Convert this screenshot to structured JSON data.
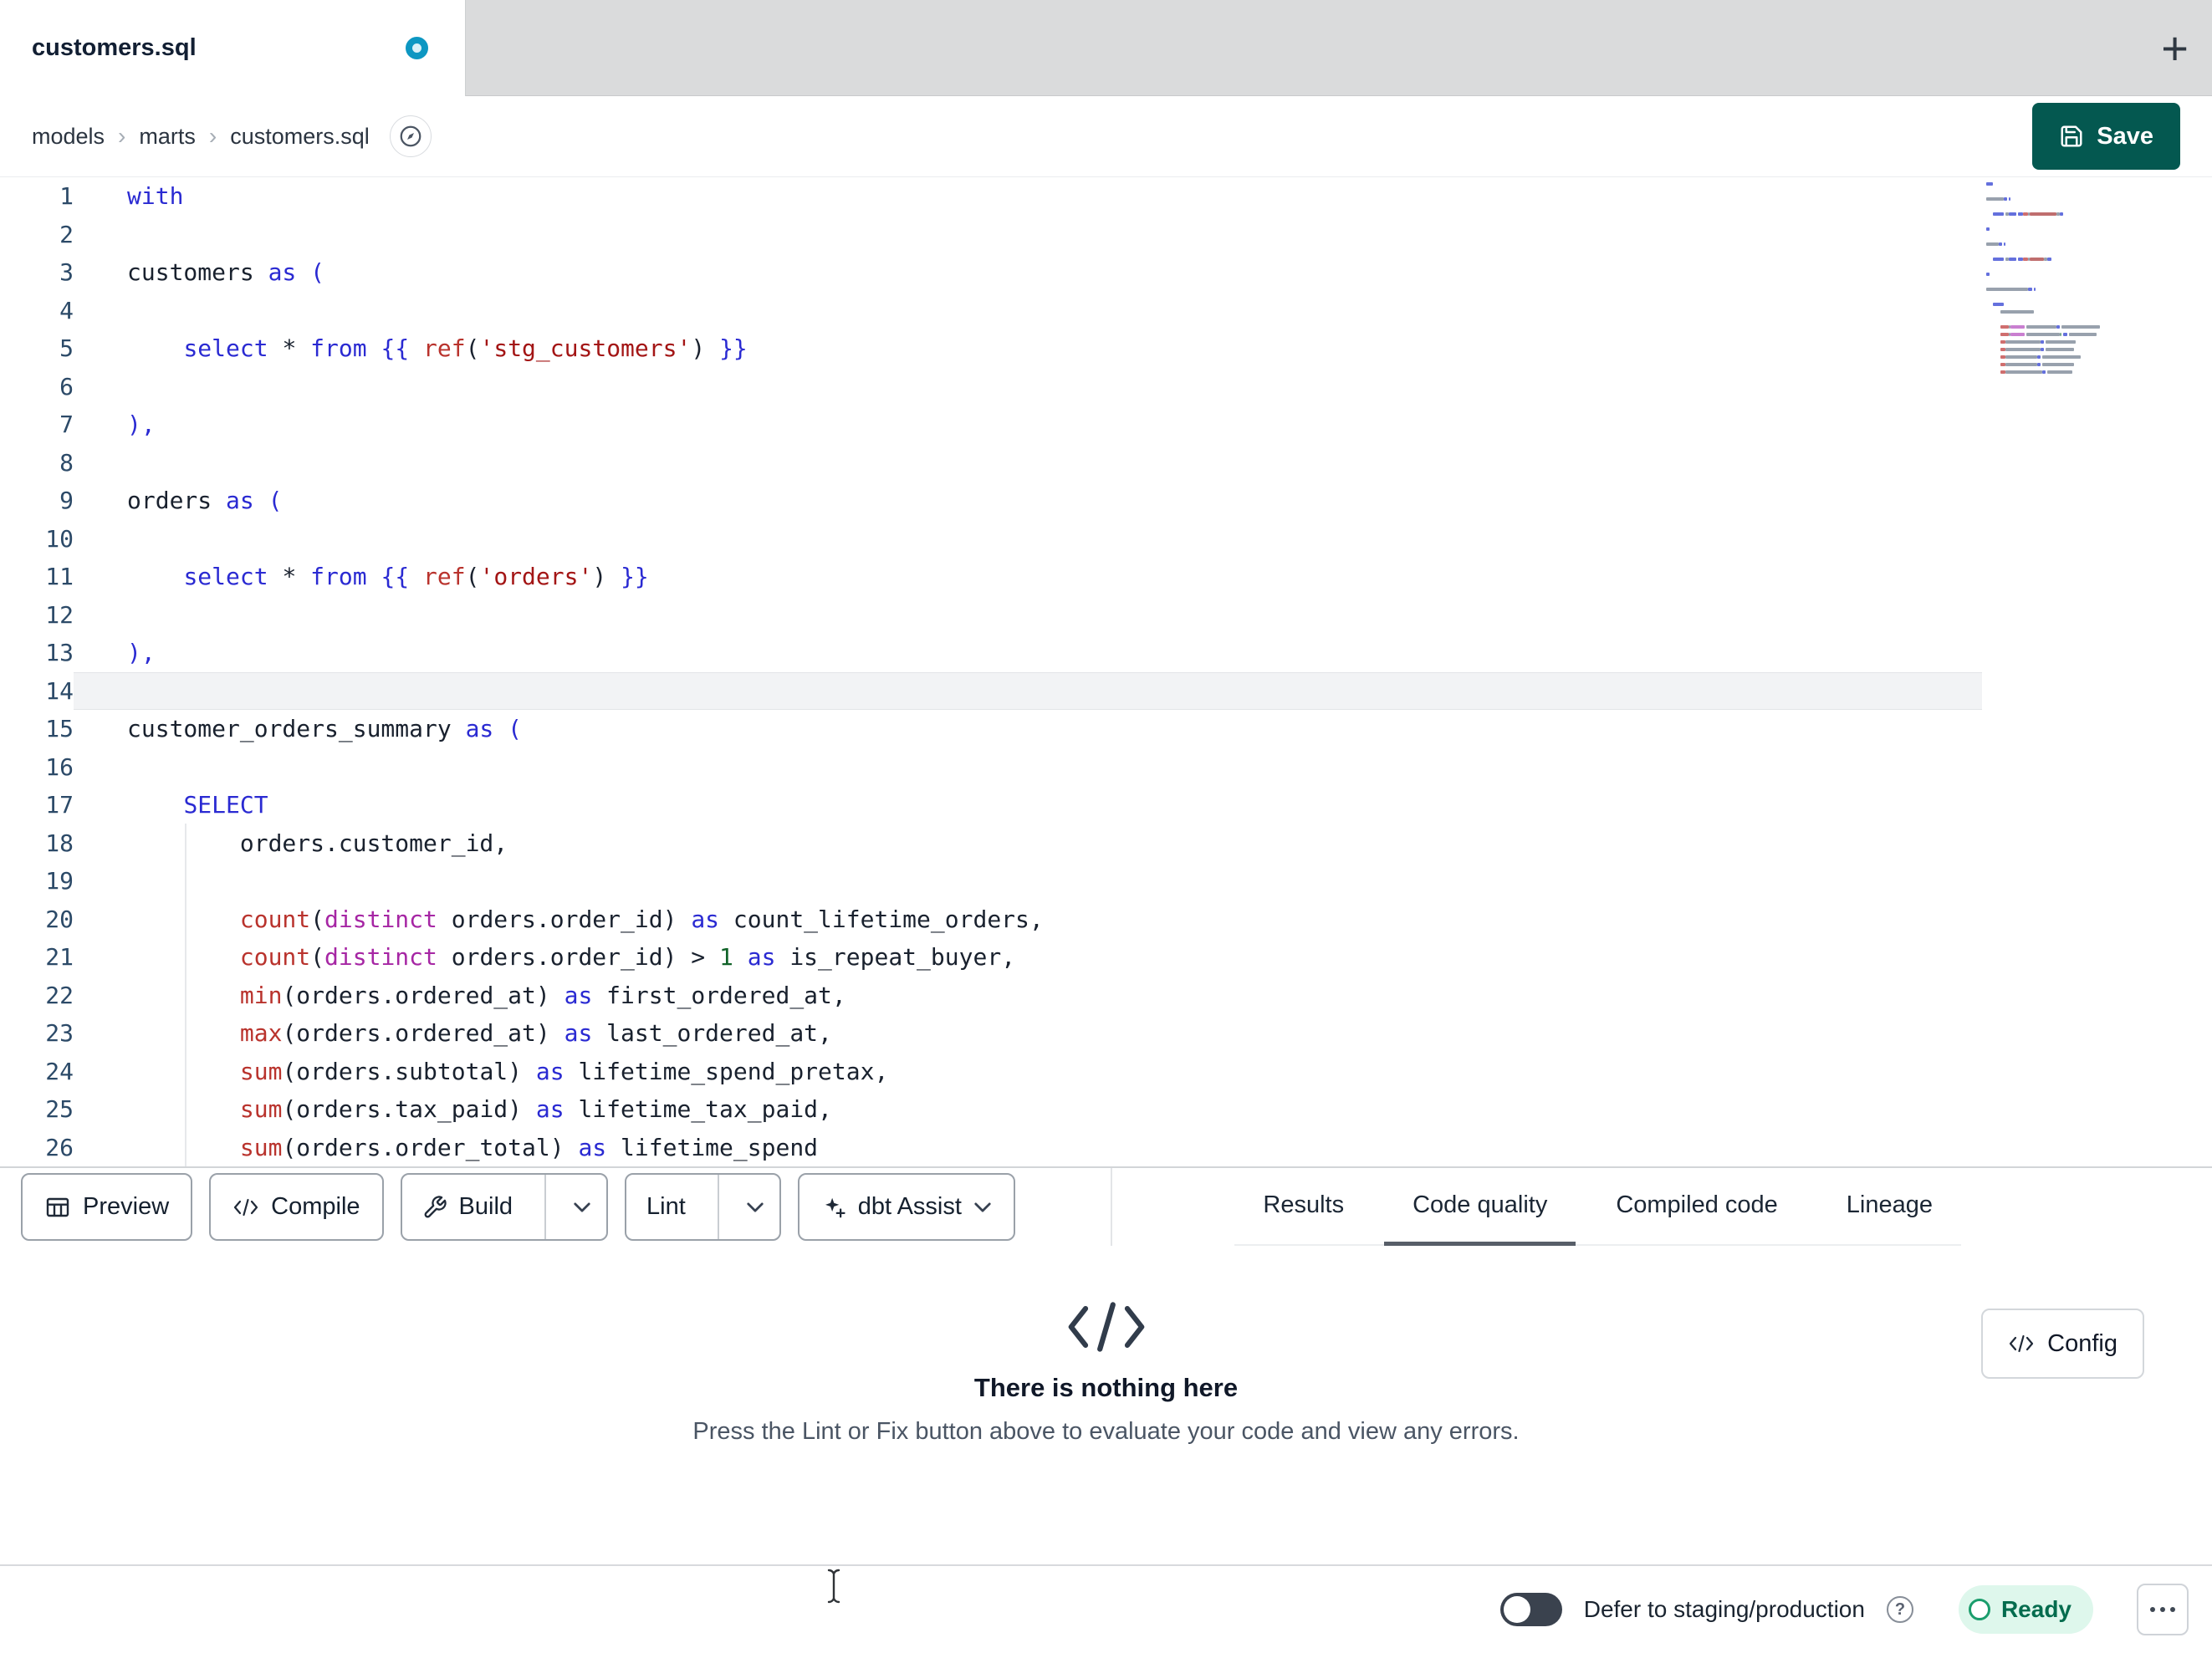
{
  "tab_bar": {
    "tab_title": "customers.sql",
    "new_tab_label": "+"
  },
  "breadcrumb": {
    "items": [
      "models",
      "marts",
      "customers.sql"
    ],
    "save_label": "Save"
  },
  "editor": {
    "current_line": 14,
    "lines": [
      {
        "n": 1,
        "segs": [
          [
            "kw",
            "with"
          ]
        ]
      },
      {
        "n": 2,
        "segs": []
      },
      {
        "n": 3,
        "segs": [
          [
            "pl",
            "customers "
          ],
          [
            "kw",
            "as"
          ],
          [
            "pl",
            " "
          ],
          [
            "br",
            "("
          ]
        ]
      },
      {
        "n": 4,
        "segs": []
      },
      {
        "n": 5,
        "segs": [
          [
            "pl",
            "    "
          ],
          [
            "kw",
            "select"
          ],
          [
            "pl",
            " * "
          ],
          [
            "kw",
            "from"
          ],
          [
            "pl",
            " "
          ],
          [
            "br",
            "{{ "
          ],
          [
            "fn",
            "ref"
          ],
          [
            "pl",
            "("
          ],
          [
            "str",
            "'stg_customers'"
          ],
          [
            "pl",
            ") "
          ],
          [
            "br",
            "}}"
          ]
        ]
      },
      {
        "n": 6,
        "segs": []
      },
      {
        "n": 7,
        "segs": [
          [
            "br",
            "),"
          ]
        ]
      },
      {
        "n": 8,
        "segs": []
      },
      {
        "n": 9,
        "segs": [
          [
            "pl",
            "orders "
          ],
          [
            "kw",
            "as"
          ],
          [
            "pl",
            " "
          ],
          [
            "br",
            "("
          ]
        ]
      },
      {
        "n": 10,
        "segs": []
      },
      {
        "n": 11,
        "segs": [
          [
            "pl",
            "    "
          ],
          [
            "kw",
            "select"
          ],
          [
            "pl",
            " * "
          ],
          [
            "kw",
            "from"
          ],
          [
            "pl",
            " "
          ],
          [
            "br",
            "{{ "
          ],
          [
            "fn",
            "ref"
          ],
          [
            "pl",
            "("
          ],
          [
            "str",
            "'orders'"
          ],
          [
            "pl",
            ") "
          ],
          [
            "br",
            "}}"
          ]
        ]
      },
      {
        "n": 12,
        "segs": []
      },
      {
        "n": 13,
        "segs": [
          [
            "br",
            "),"
          ]
        ]
      },
      {
        "n": 14,
        "segs": []
      },
      {
        "n": 15,
        "segs": [
          [
            "pl",
            "customer_orders_summary "
          ],
          [
            "kw",
            "as"
          ],
          [
            "pl",
            " "
          ],
          [
            "br",
            "("
          ]
        ]
      },
      {
        "n": 16,
        "segs": []
      },
      {
        "n": 17,
        "segs": [
          [
            "pl",
            "    "
          ],
          [
            "kw",
            "SELECT"
          ]
        ]
      },
      {
        "n": 18,
        "segs": [
          [
            "pl",
            "        orders.customer_id,"
          ]
        ]
      },
      {
        "n": 19,
        "segs": []
      },
      {
        "n": 20,
        "segs": [
          [
            "pl",
            "        "
          ],
          [
            "fn",
            "count"
          ],
          [
            "pl",
            "("
          ],
          [
            "typ",
            "distinct"
          ],
          [
            "pl",
            " orders.order_id) "
          ],
          [
            "kw",
            "as"
          ],
          [
            "pl",
            " count_lifetime_orders,"
          ]
        ]
      },
      {
        "n": 21,
        "segs": [
          [
            "pl",
            "        "
          ],
          [
            "fn",
            "count"
          ],
          [
            "pl",
            "("
          ],
          [
            "typ",
            "distinct"
          ],
          [
            "pl",
            " orders.order_id) > "
          ],
          [
            "num",
            "1"
          ],
          [
            "pl",
            " "
          ],
          [
            "kw",
            "as"
          ],
          [
            "pl",
            " is_repeat_buyer,"
          ]
        ]
      },
      {
        "n": 22,
        "segs": [
          [
            "pl",
            "        "
          ],
          [
            "fn",
            "min"
          ],
          [
            "pl",
            "(orders.ordered_at) "
          ],
          [
            "kw",
            "as"
          ],
          [
            "pl",
            " first_ordered_at,"
          ]
        ]
      },
      {
        "n": 23,
        "segs": [
          [
            "pl",
            "        "
          ],
          [
            "fn",
            "max"
          ],
          [
            "pl",
            "(orders.ordered_at) "
          ],
          [
            "kw",
            "as"
          ],
          [
            "pl",
            " last_ordered_at,"
          ]
        ]
      },
      {
        "n": 24,
        "segs": [
          [
            "pl",
            "        "
          ],
          [
            "fn",
            "sum"
          ],
          [
            "pl",
            "(orders.subtotal) "
          ],
          [
            "kw",
            "as"
          ],
          [
            "pl",
            " lifetime_spend_pretax,"
          ]
        ]
      },
      {
        "n": 25,
        "segs": [
          [
            "pl",
            "        "
          ],
          [
            "fn",
            "sum"
          ],
          [
            "pl",
            "(orders.tax_paid) "
          ],
          [
            "kw",
            "as"
          ],
          [
            "pl",
            " lifetime_tax_paid,"
          ]
        ]
      },
      {
        "n": 26,
        "segs": [
          [
            "pl",
            "        "
          ],
          [
            "fn",
            "sum"
          ],
          [
            "pl",
            "(orders.order_total) "
          ],
          [
            "kw",
            "as"
          ],
          [
            "pl",
            " lifetime_spend"
          ]
        ]
      }
    ]
  },
  "toolbar": {
    "preview_label": "Preview",
    "compile_label": "Compile",
    "build_label": "Build",
    "lint_label": "Lint",
    "assist_label": "dbt Assist",
    "tabs": [
      {
        "label": "Results",
        "active": false
      },
      {
        "label": "Code quality",
        "active": true
      },
      {
        "label": "Compiled code",
        "active": false
      },
      {
        "label": "Lineage",
        "active": false
      }
    ]
  },
  "empty_state": {
    "title": "There is nothing here",
    "subtitle": "Press the Lint or Fix button above to evaluate your code and view any errors.",
    "config_label": "Config"
  },
  "status_bar": {
    "defer_label": "Defer to staging/production",
    "ready_label": "Ready",
    "toggle_on": false
  },
  "colors": {
    "keyword": "#2a2ad2",
    "function_red": "#b9332d",
    "string_red": "#a31515",
    "distinct_purple": "#a626a4",
    "number_green": "#116329",
    "bracket_blue": "#2a2ad2",
    "save_teal": "#045850",
    "tab_dot_blue": "#0d97c2",
    "ready_green_bg": "#def7ec",
    "ready_green_text": "#046c4e",
    "active_underline": "#575e68"
  }
}
